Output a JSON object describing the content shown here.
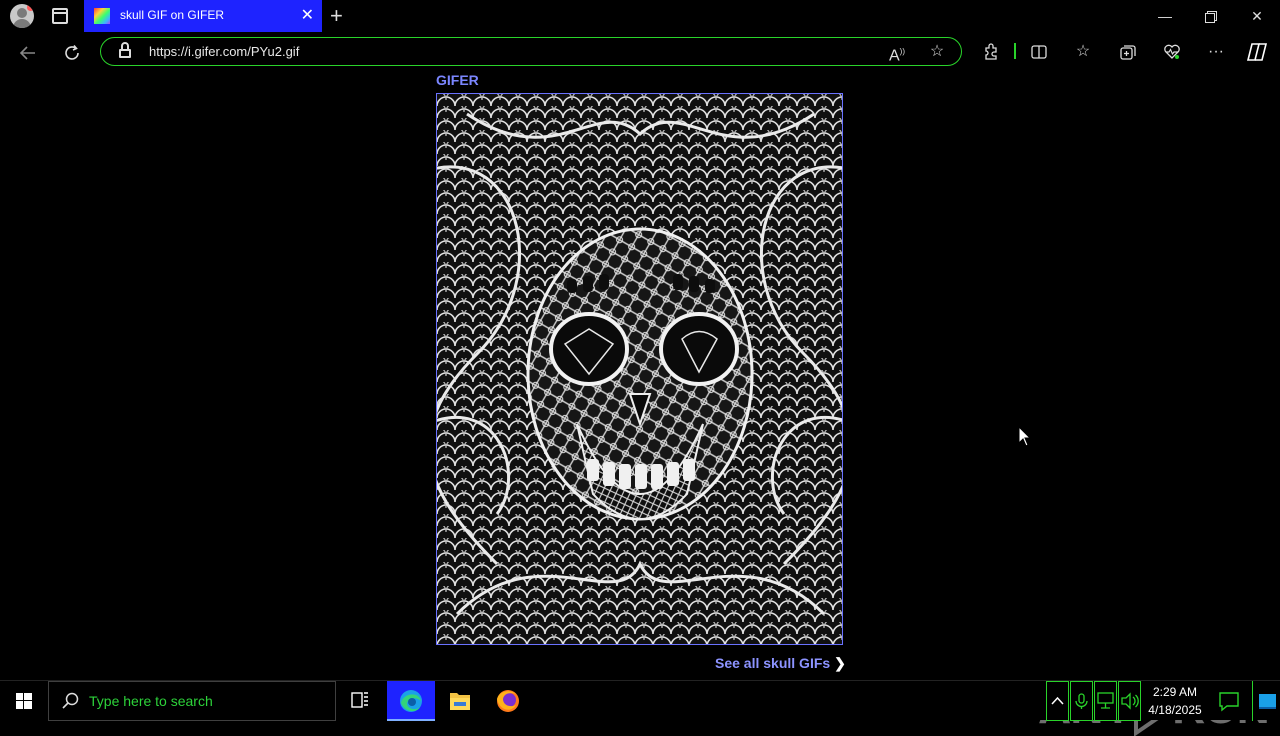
{
  "browser": {
    "tab_title": "skull GIF on GIFER",
    "url": "https://i.gifer.com/PYu2.gif",
    "new_tab_label": "+"
  },
  "page": {
    "site_name": "GIFER",
    "see_all_label": "See all skull GIFs",
    "gif_subject": "skull"
  },
  "watermark": {
    "text_left": "ANY",
    "text_right": "RUN"
  },
  "taskbar": {
    "search_placeholder": "Type here to search",
    "time": "2:29 AM",
    "date": "4/18/2025"
  },
  "colors": {
    "tab_active": "#1e23ff",
    "address_border": "#29d32a",
    "site_accent": "#7b86ff",
    "search_placeholder": "#2dd23a"
  },
  "icons": [
    "profile-icon",
    "tab-actions-icon",
    "tab-favicon",
    "close-tab-icon",
    "new-tab-icon",
    "minimize-icon",
    "restore-icon",
    "close-window-icon",
    "back-icon",
    "refresh-icon",
    "lock-icon",
    "read-aloud-icon",
    "favorite-star-icon",
    "extensions-icon",
    "split-screen-icon",
    "favorites-icon",
    "collections-icon",
    "browser-essentials-icon",
    "more-menu-icon",
    "copilot-icon",
    "windows-start-icon",
    "search-icon",
    "task-view-icon",
    "edge-icon",
    "file-explorer-icon",
    "firefox-icon",
    "tray-chevron-icon",
    "microphone-icon",
    "network-icon",
    "volume-icon",
    "notification-icon"
  ]
}
